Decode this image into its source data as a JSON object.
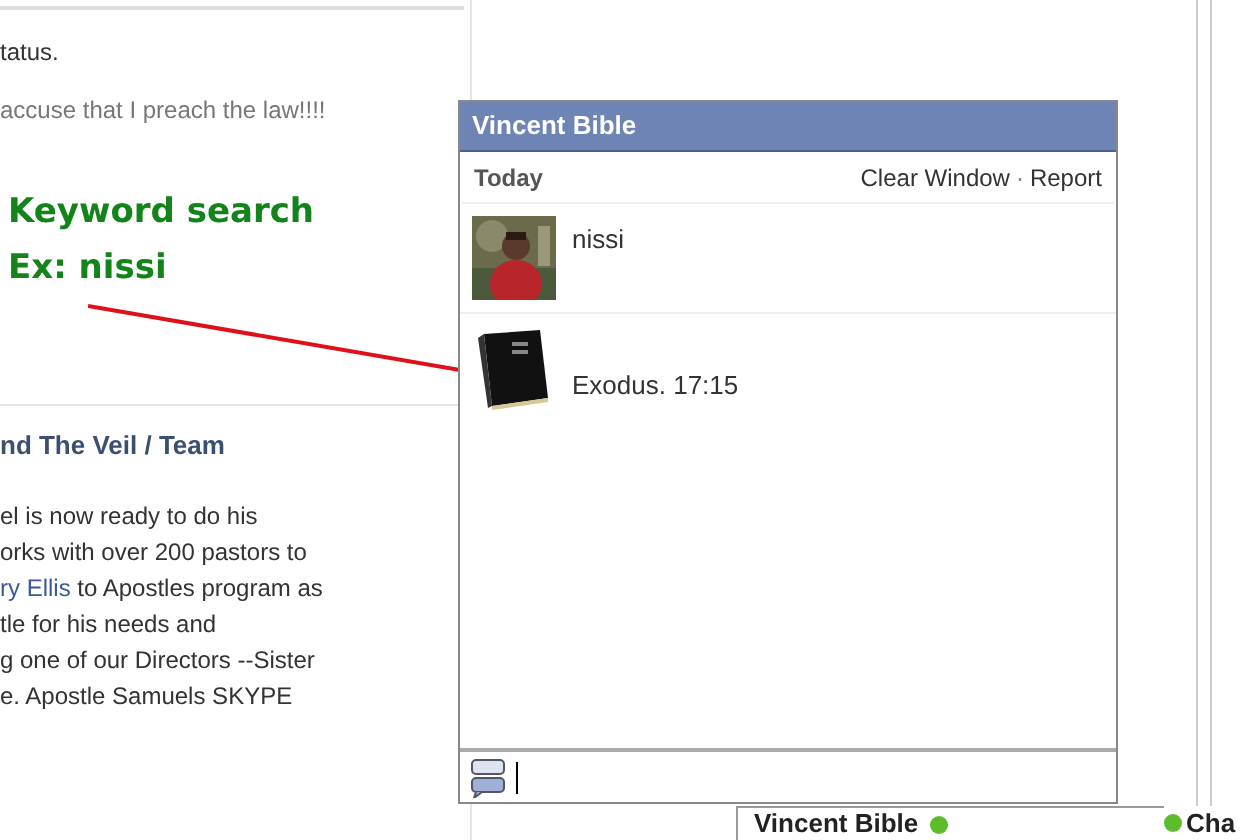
{
  "feed": {
    "status_line": "tatus.",
    "comment": "accuse that I preach the law!!!!",
    "heading": "nd The Veil / Team",
    "paragraph": [
      [
        {
          "kind": "plain",
          "text": "el is now ready to do his"
        }
      ],
      [
        {
          "kind": "plain",
          "text": "orks with over 200 pastors to"
        }
      ],
      [
        {
          "kind": "link",
          "text": "ry Ellis"
        },
        {
          "kind": "plain",
          "text": " to Apostles program as"
        }
      ],
      [
        {
          "kind": "plain",
          "text": "tle for his needs and"
        }
      ],
      [
        {
          "kind": "plain",
          "text": "g one of our Directors --Sister"
        }
      ],
      [
        {
          "kind": "plain",
          "text": "e. Apostle Samuels SKYPE"
        }
      ]
    ]
  },
  "annotation": {
    "lines": [
      "Keyword search",
      "Ex: nissi"
    ]
  },
  "chat_window": {
    "title": "Vincent Bible",
    "day": "Today",
    "actions": [
      "Clear Window",
      "Report"
    ],
    "action_separator": "·",
    "messages": [
      {
        "text": "nissi"
      },
      {
        "kind": "book",
        "text": "Exodus. 17:15"
      }
    ]
  },
  "chat_bar": {
    "tab": {
      "title": "Vincent Bible",
      "online": true
    },
    "chat_label": "Cha"
  }
}
